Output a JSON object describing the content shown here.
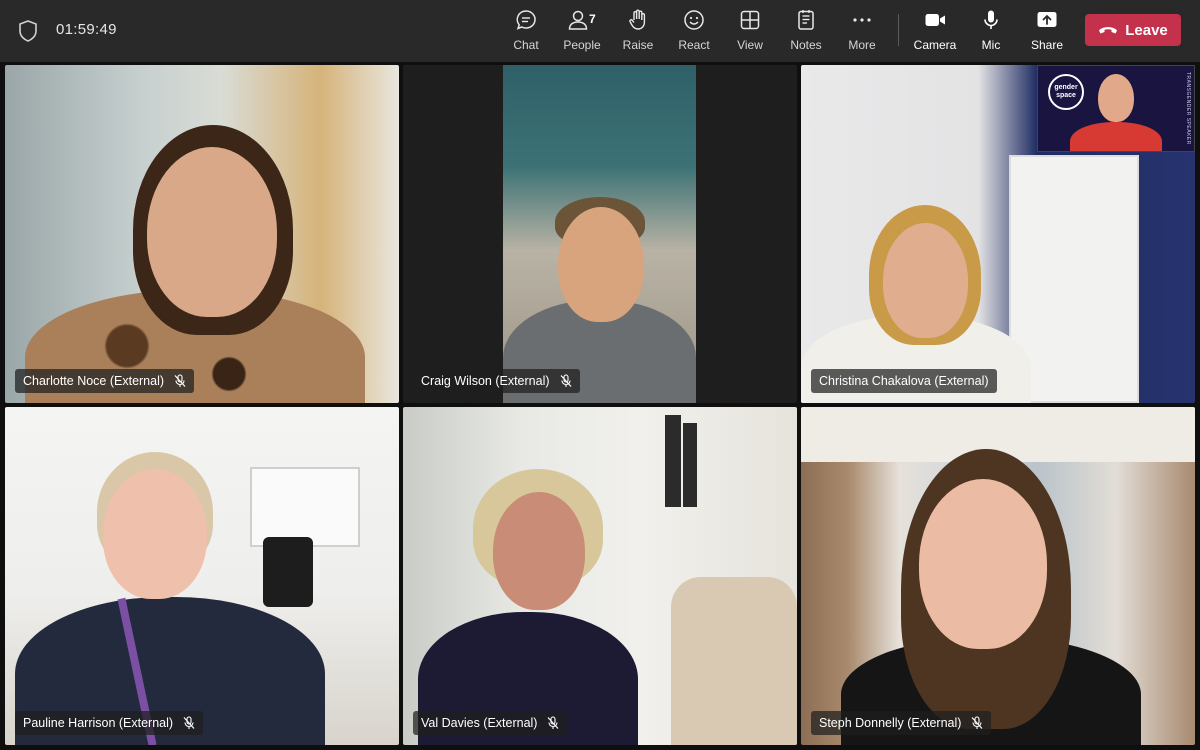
{
  "call": {
    "timer": "01:59:49"
  },
  "toolbar": {
    "chat_label": "Chat",
    "people_label": "People",
    "people_count": "7",
    "raise_label": "Raise",
    "react_label": "React",
    "view_label": "View",
    "notes_label": "Notes",
    "more_label": "More",
    "camera_label": "Camera",
    "mic_label": "Mic",
    "share_label": "Share",
    "leave_label": "Leave"
  },
  "participants": [
    {
      "name": "Charlotte Noce (External)",
      "muted": true
    },
    {
      "name": "Craig Wilson (External)",
      "muted": true
    },
    {
      "name": "Christina Chakalova (External)",
      "muted": false
    },
    {
      "name": "Pauline Harrison (External)",
      "muted": true
    },
    {
      "name": "Val Davies (External)",
      "muted": true
    },
    {
      "name": "Steph Donnelly (External)",
      "muted": true
    }
  ],
  "pip": {
    "logo_line1": "gender",
    "logo_line2": "space",
    "side_text": "TRANSGENDER SPEAKER"
  },
  "colors": {
    "leave_red": "#c4314b",
    "toolbar_bg": "#292929"
  }
}
